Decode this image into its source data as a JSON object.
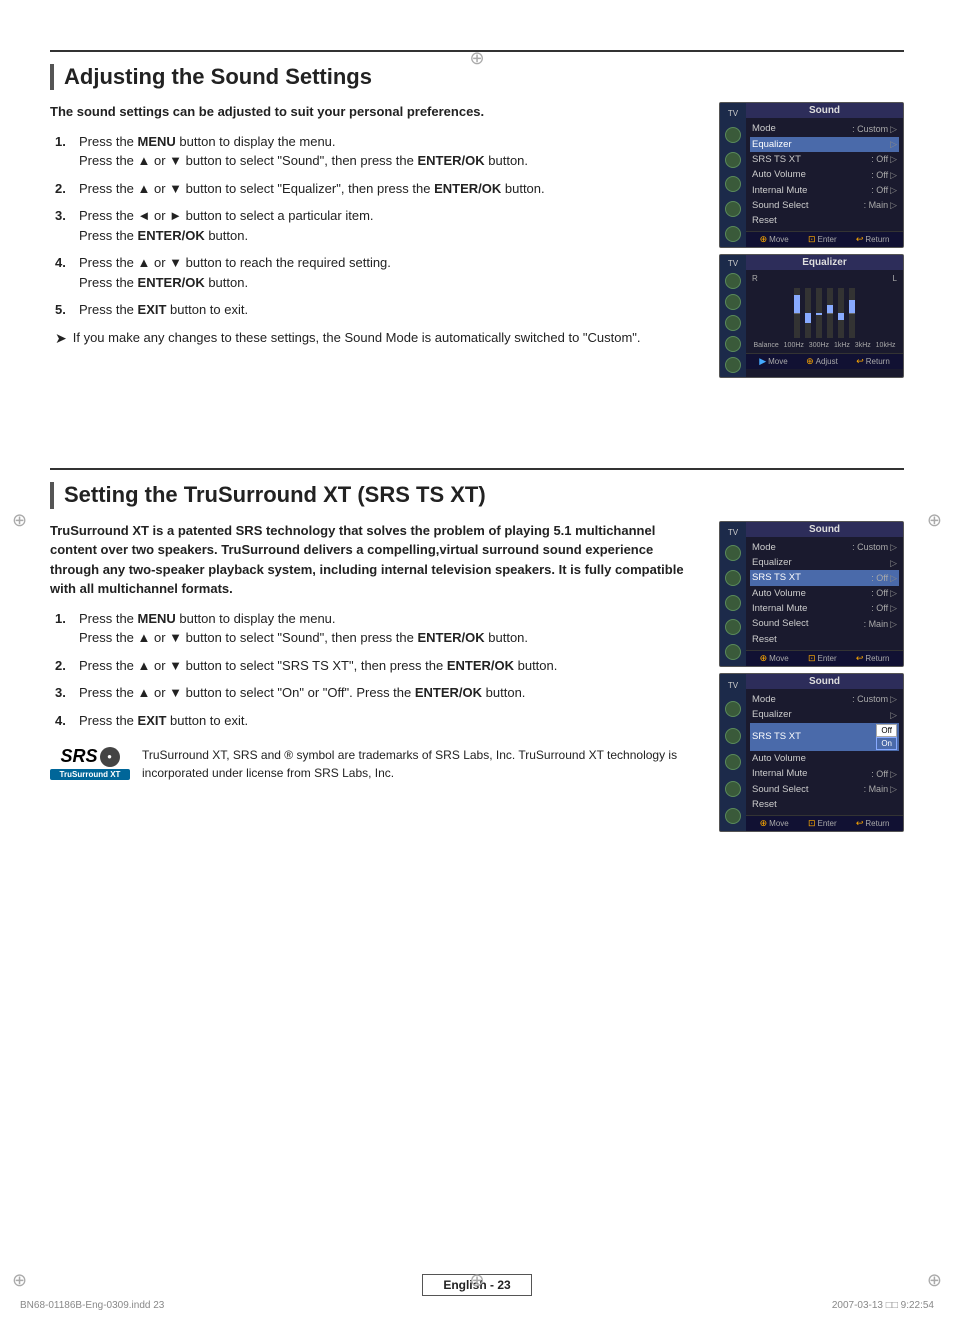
{
  "page": {
    "section1": {
      "title": "Adjusting the Sound Settings",
      "intro": "The sound settings can be adjusted to suit your personal preferences.",
      "steps": [
        {
          "num": "1.",
          "text": "Press the MENU button to display the menu. Press the ▲ or ▼ button to select \"Sound\", then press the ENTER/OK button."
        },
        {
          "num": "2.",
          "text": "Press the ▲ or ▼ button to select \"Equalizer\", then press the ENTER/OK button."
        },
        {
          "num": "3.",
          "text": "Press the ◄ or ► button to select a particular item. Press the ENTER/OK button."
        },
        {
          "num": "4.",
          "text": "Press the ▲ or ▼ button to reach the required setting. Press the ENTER/OK button."
        },
        {
          "num": "5.",
          "text": "Press the EXIT button to exit."
        }
      ],
      "note": "If you make any changes to these settings, the Sound Mode is automatically switched to \"Custom\".",
      "panel1": {
        "header": "Sound",
        "rows": [
          {
            "label": "Mode",
            "value": ": Custom",
            "arrow": "▷",
            "highlight": false,
            "selected": false
          },
          {
            "label": "Equalizer",
            "value": "",
            "arrow": "▷",
            "highlight": true,
            "selected": false
          },
          {
            "label": "SRS TS XT",
            "value": ": Off",
            "arrow": "▷",
            "highlight": false,
            "selected": false
          },
          {
            "label": "Auto Volume",
            "value": ": Off",
            "arrow": "▷",
            "highlight": false,
            "selected": false
          },
          {
            "label": "Internal Mute",
            "value": ": Off",
            "arrow": "▷",
            "highlight": false,
            "selected": false
          },
          {
            "label": "Sound Select",
            "value": ": Main",
            "arrow": "▷",
            "highlight": false,
            "selected": false
          },
          {
            "label": "Reset",
            "value": "",
            "arrow": "",
            "highlight": false,
            "selected": false
          }
        ],
        "footer": [
          "Move",
          "Enter",
          "Return"
        ]
      },
      "panel2": {
        "header": "Equalizer",
        "labels": [
          "Balance",
          "100Hz",
          "300Hz",
          "1kHz",
          "3kHz",
          "10kHz"
        ],
        "footer": [
          "Move",
          "Adjust",
          "Return"
        ]
      }
    },
    "section2": {
      "title": "Setting the TruSurround XT (SRS TS XT)",
      "intro": "TruSurround XT is a patented SRS technology that solves the problem of playing 5.1 multichannel content over two speakers. TruSurround delivers a compelling,virtual surround sound experience through any two-speaker playback system, including internal television speakers. It is fully compatible with all multichannel formats.",
      "steps": [
        {
          "num": "1.",
          "text": "Press the MENU button to display the menu. Press the ▲ or ▼ button to select \"Sound\", then press the ENTER/OK button."
        },
        {
          "num": "2.",
          "text": "Press the ▲ or ▼ button to select \"SRS TS XT\", then press the ENTER/OK button."
        },
        {
          "num": "3.",
          "text": "Press the ▲ or ▼ button to select \"On\" or \"Off\". Press the ENTER/OK button."
        },
        {
          "num": "4.",
          "text": "Press the EXIT button to exit."
        }
      ],
      "srs_desc": "TruSurround XT, SRS and ® symbol are trademarks of SRS Labs, Inc. TruSurround XT technology is incorporated under license from SRS Labs, Inc.",
      "panel3": {
        "header": "Sound",
        "rows": [
          {
            "label": "Mode",
            "value": ": Custom",
            "arrow": "▷",
            "highlight": false
          },
          {
            "label": "Equalizer",
            "value": "",
            "arrow": "▷",
            "highlight": false
          },
          {
            "label": "SRS TS XT",
            "value": ": Off",
            "arrow": "▷",
            "highlight": true
          },
          {
            "label": "Auto Volume",
            "value": ": Off",
            "arrow": "▷",
            "highlight": false
          },
          {
            "label": "Internal Mute",
            "value": ": Off",
            "arrow": "▷",
            "highlight": false
          },
          {
            "label": "Sound Select",
            "value": ": Main",
            "arrow": "▷",
            "highlight": false
          },
          {
            "label": "Reset",
            "value": "",
            "arrow": "",
            "highlight": false
          }
        ],
        "footer": [
          "Move",
          "Enter",
          "Return"
        ]
      },
      "panel4": {
        "header": "Sound",
        "rows": [
          {
            "label": "Mode",
            "value": ": Custom",
            "arrow": "▷",
            "highlight": false
          },
          {
            "label": "Equalizer",
            "value": "",
            "arrow": "▷",
            "highlight": false
          },
          {
            "label": "SRS TS XT",
            "value": ":",
            "arrow": "",
            "highlight": true,
            "dropdown": true,
            "dropdown_off": "Off",
            "dropdown_on": "On"
          },
          {
            "label": "Auto Volume",
            "value": "",
            "arrow": "",
            "highlight": false
          },
          {
            "label": "Internal Mute",
            "value": ": Off",
            "arrow": "▷",
            "highlight": false
          },
          {
            "label": "Sound Select",
            "value": ": Main",
            "arrow": "▷",
            "highlight": false
          },
          {
            "label": "Reset",
            "value": "",
            "arrow": "",
            "highlight": false
          }
        ],
        "footer": [
          "Move",
          "Enter",
          "Return"
        ]
      }
    },
    "footer": {
      "page_label": "English - 23",
      "file_left": "BN68-01186B-Eng-0309.indd   23",
      "file_right": "2007-03-13   □□ 9:22:54"
    }
  }
}
